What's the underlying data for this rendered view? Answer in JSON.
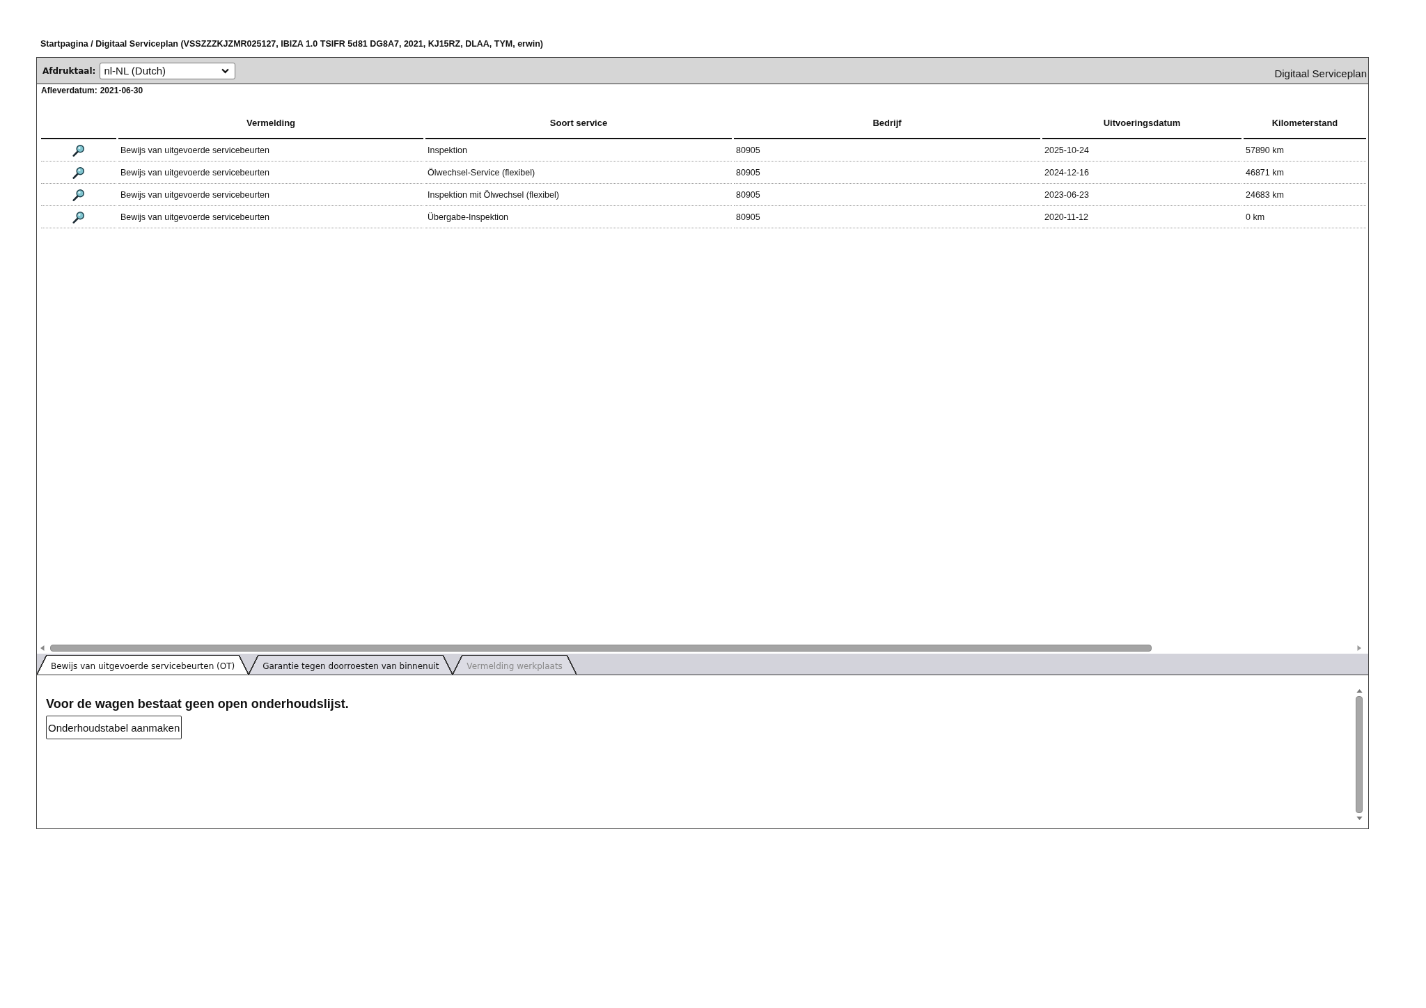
{
  "breadcrumb": "Startpagina / Digitaal Serviceplan (VSSZZZKJZMR025127, IBIZA 1.0 TSIFR 5d81 DG8A7, 2021, KJ15RZ, DLAA, TYM, erwin)",
  "toolbar": {
    "print_language_label": "Afdruktaal:",
    "print_language": "nl-NL (Dutch)",
    "title": "Digitaal Serviceplan"
  },
  "delivery_date": {
    "label": "Afleverdatum:",
    "value": "2021-06-30"
  },
  "table": {
    "columns": [
      "Vermelding",
      "Soort service",
      "Bedrijf",
      "Uitvoeringsdatum",
      "Kilometerstand"
    ],
    "rows": [
      {
        "vermelding": "Bewijs van uitgevoerde servicebeurten",
        "soort_service": "Inspektion",
        "bedrijf": "80905",
        "uitvoeringsdatum": "2025-10-24",
        "kilometerstand": "57890 km"
      },
      {
        "vermelding": "Bewijs van uitgevoerde servicebeurten",
        "soort_service": "Ölwechsel-Service (flexibel)",
        "bedrijf": "80905",
        "uitvoeringsdatum": "2024-12-16",
        "kilometerstand": "46871 km"
      },
      {
        "vermelding": "Bewijs van uitgevoerde servicebeurten",
        "soort_service": "Inspektion mit Ölwechsel (flexibel)",
        "bedrijf": "80905",
        "uitvoeringsdatum": "2023-06-23",
        "kilometerstand": "24683 km"
      },
      {
        "vermelding": "Bewijs van uitgevoerde servicebeurten",
        "soort_service": "Übergabe-Inspektion",
        "bedrijf": "80905",
        "uitvoeringsdatum": "2020-11-12",
        "kilometerstand": "0 km"
      }
    ]
  },
  "tabs": [
    {
      "label": "Bewijs van uitgevoerde servicebeurten (OT)",
      "selected": true,
      "disabled": false
    },
    {
      "label": "Garantie tegen doorroesten van binnenuit",
      "selected": false,
      "disabled": false
    },
    {
      "label": "Vermelding werkplaats",
      "selected": false,
      "disabled": true
    }
  ],
  "tab_panel": {
    "message": "Voor de wagen bestaat geen open onderhoudslijst.",
    "button": "Onderhoudstabel aanmaken"
  }
}
